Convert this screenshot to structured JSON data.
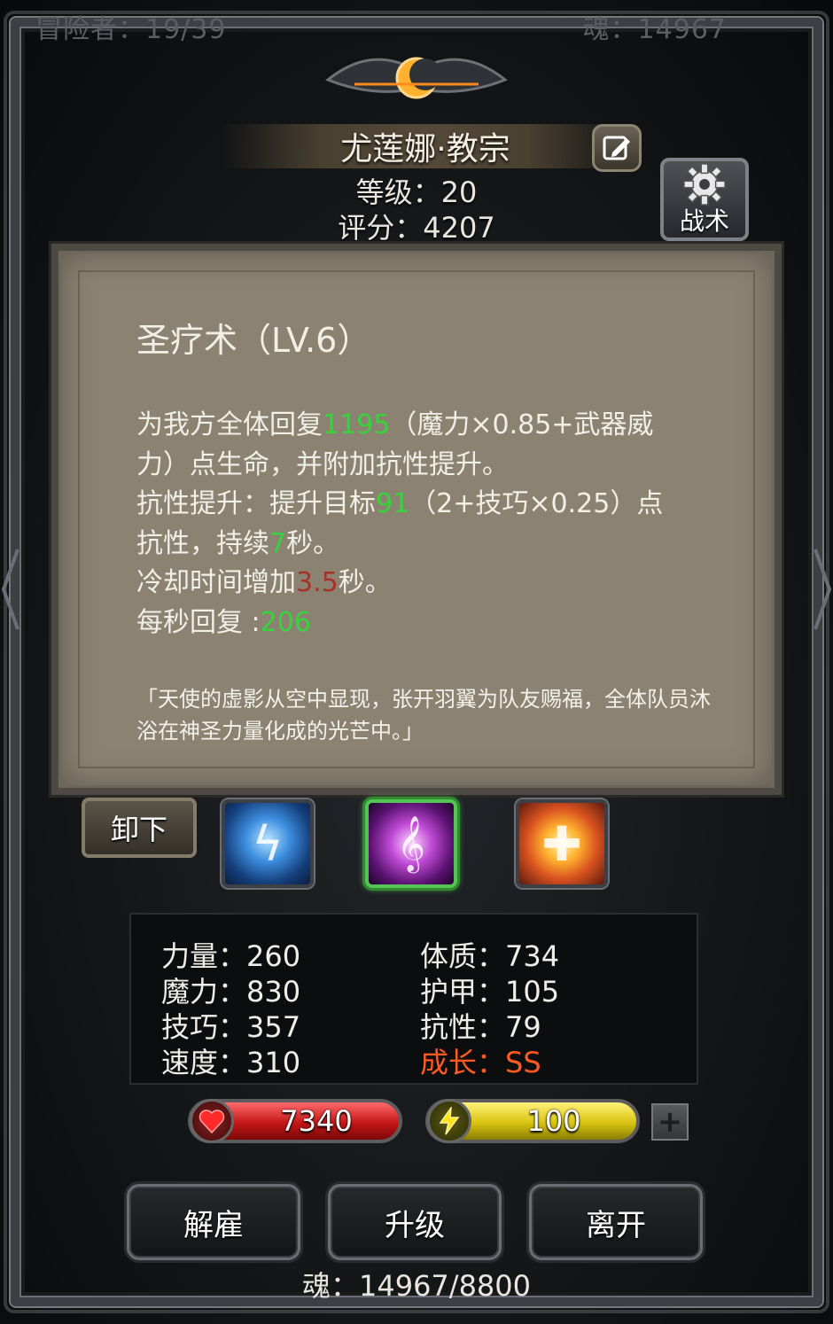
{
  "top_bar": {
    "left_text": "冒险者：19/39",
    "right_text": "魂：14967"
  },
  "hero": {
    "name": "尤莲娜·教宗",
    "level_text": "等级：20",
    "score_text": "评分：4207"
  },
  "tactics_button": {
    "label": "战术",
    "icon": "gear-icon"
  },
  "skill": {
    "title": "圣疗术（LV.6）",
    "desc": {
      "l1a": "为我方全体回复",
      "heal": "1195",
      "l1b": "（魔力×0.85+武器威",
      "l2": "力）点生命，并附加抗性提升。",
      "l3a": "抗性提升：提升目标",
      "res": "91",
      "l3b": "（2+技巧×0.25）点",
      "l4a": "抗性，持续",
      "dur": "7",
      "l4b": "秒。",
      "l5a": "冷却时间增加",
      "cd": "3.5",
      "l5b": "秒。",
      "l6a": "每秒回复 :",
      "regen": "206"
    },
    "lore": "「天使的虚影从空中显现，张开羽翼为队友赐福，全体队员沐浴在神圣力量化成的光芒中。」"
  },
  "unequip_button": "卸下",
  "skill_slots": [
    {
      "name": "lightning-skill-icon",
      "selected": false
    },
    {
      "name": "holy-heal-skill-icon",
      "selected": true
    },
    {
      "name": "cross-shield-skill-icon",
      "selected": false
    }
  ],
  "stats": {
    "str": "力量：260",
    "mag": "魔力：830",
    "dex": "技巧：357",
    "spd": "速度：310",
    "con": "体质：734",
    "armor": "护甲：105",
    "resist": "抗性：79",
    "growth": "成长：SS"
  },
  "bars": {
    "hp": "7340",
    "energy": "100"
  },
  "actions": {
    "fire": "解雇",
    "upgrade": "升级",
    "leave": "离开"
  },
  "footer": {
    "soul": "魂：14967/8800"
  },
  "colors": {
    "highlight_green": "#39d23d",
    "highlight_red": "#a83228",
    "growth_orange": "#ff5a1f",
    "panel_bg": "#8b8272"
  }
}
